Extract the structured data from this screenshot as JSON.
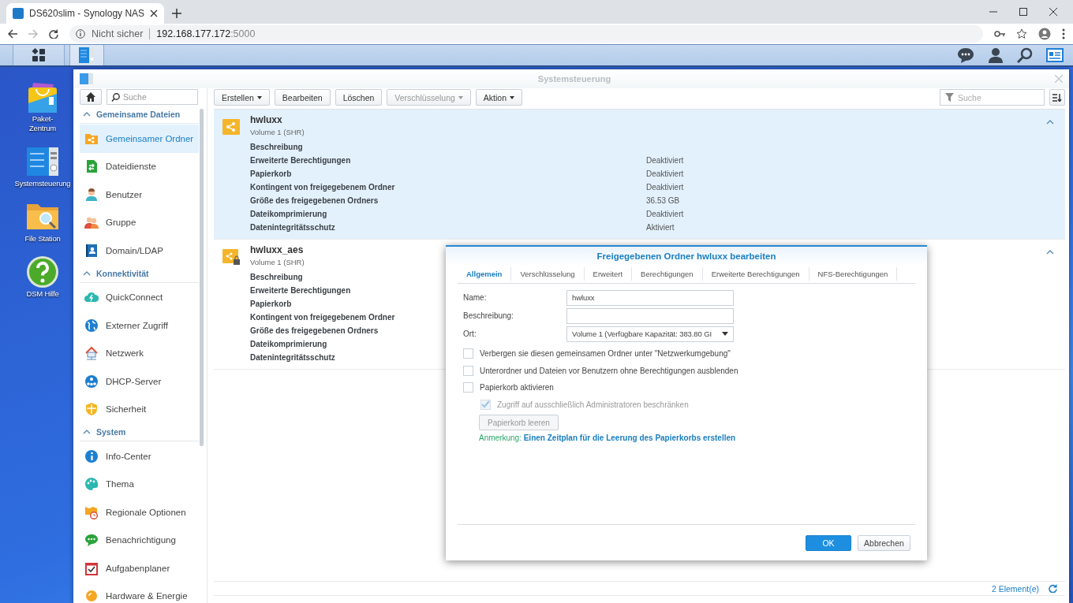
{
  "browser": {
    "tab_title": "DS620slim - Synology NAS",
    "security_label": "Nicht sicher",
    "url_host": "192.168.177.172",
    "url_port": ":5000"
  },
  "desktop_icons": [
    {
      "kind": "package",
      "label": "Paket-\nZentrum"
    },
    {
      "kind": "control-panel",
      "label": "Systemsteuerung"
    },
    {
      "kind": "file-station",
      "label": "File Station"
    },
    {
      "kind": "help",
      "label": "DSM Hilfe"
    }
  ],
  "window": {
    "title": "Systemsteuerung",
    "search": {
      "placeholder": "Suche"
    }
  },
  "sidebar": {
    "search": {
      "placeholder": "Suche"
    },
    "sections": [
      {
        "title": "Gemeinsame Dateien",
        "expanded": true,
        "items": [
          {
            "kind": "shared-folder",
            "label": "Gemeinsamer Ordner",
            "selected": true
          },
          {
            "kind": "file-services",
            "label": "Dateidienste",
            "selected": false
          },
          {
            "kind": "user",
            "label": "Benutzer",
            "selected": false
          },
          {
            "kind": "group",
            "label": "Gruppe",
            "selected": false
          },
          {
            "kind": "directory",
            "label": "Domain/LDAP",
            "selected": false
          }
        ]
      },
      {
        "title": "Konnektivität",
        "expanded": true,
        "items": [
          {
            "kind": "cloud",
            "label": "QuickConnect",
            "selected": false
          },
          {
            "kind": "globe",
            "label": "Externer Zugriff",
            "selected": false
          },
          {
            "kind": "house",
            "label": "Netzwerk",
            "selected": false
          },
          {
            "kind": "dhcp",
            "label": "DHCP-Server",
            "selected": false
          },
          {
            "kind": "shield",
            "label": "Sicherheit",
            "selected": false
          }
        ]
      },
      {
        "title": "System",
        "expanded": true,
        "items": [
          {
            "kind": "info",
            "label": "Info-Center",
            "selected": false
          },
          {
            "kind": "palette",
            "label": "Thema",
            "selected": false
          },
          {
            "kind": "regional",
            "label": "Regionale Optionen",
            "selected": false
          },
          {
            "kind": "chat",
            "label": "Benachrichtigung",
            "selected": false
          },
          {
            "kind": "calendar",
            "label": "Aufgabenplaner",
            "selected": false
          },
          {
            "kind": "bulb",
            "label": "Hardware & Energie",
            "selected": false
          }
        ]
      }
    ]
  },
  "toolbar": {
    "buttons": [
      {
        "label": "Erstellen",
        "dropdown": true,
        "disabled": false
      },
      {
        "label": "Bearbeiten",
        "dropdown": false,
        "disabled": false
      },
      {
        "label": "Löschen",
        "dropdown": false,
        "disabled": false
      },
      {
        "label": "Verschlüsselung",
        "dropdown": true,
        "disabled": true
      },
      {
        "label": "Aktion",
        "dropdown": true,
        "disabled": false
      }
    ]
  },
  "folders": [
    {
      "kind": "shared",
      "name": "hwluxx",
      "volume": "Volume 1 (SHR)",
      "selected": true,
      "expanded": true,
      "properties": [
        {
          "label": "Beschreibung"
        },
        {
          "label": "Erweiterte Berechtigungen",
          "value": "Deaktiviert"
        },
        {
          "label": "Papierkorb",
          "value": "Deaktiviert"
        },
        {
          "label": "Kontingent von freigegebenem Ordner",
          "value": "Deaktiviert"
        },
        {
          "label": "Größe des freigegebenen Ordners",
          "value": "36.53 GB"
        },
        {
          "label": "Dateikomprimierung",
          "value": "Deaktiviert"
        },
        {
          "label": "Datenintegritätsschutz",
          "value": "Aktiviert"
        }
      ]
    },
    {
      "kind": "encrypted",
      "name": "hwluxx_aes",
      "volume": "Volume 1 (SHR)",
      "selected": false,
      "expanded": true,
      "properties": [
        {
          "label": "Beschreibung"
        },
        {
          "label": "Erweiterte Berechtigungen"
        },
        {
          "label": "Papierkorb"
        },
        {
          "label": "Kontingent von freigegebenem Ordner"
        },
        {
          "label": "Größe des freigegebenen Ordners"
        },
        {
          "label": "Dateikomprimierung"
        },
        {
          "label": "Datenintegritätsschutz"
        }
      ]
    }
  ],
  "status_bar": {
    "count": "2 Element(e)"
  },
  "dialog": {
    "title": "Freigegebenen Ordner hwluxx bearbeiten",
    "tabs": [
      {
        "label": "Allgemein",
        "selected": true
      },
      {
        "label": "Verschlüsselung",
        "selected": false
      },
      {
        "label": "Erweitert",
        "selected": false
      },
      {
        "label": "Berechtigungen",
        "selected": false
      },
      {
        "label": "Erweiterte Berechtigungen",
        "selected": false
      },
      {
        "label": "NFS-Berechtigungen",
        "selected": false
      }
    ],
    "fields": [
      {
        "kind": "text",
        "label": "Name:",
        "value": "hwluxx"
      },
      {
        "kind": "text",
        "label": "Beschreibung:"
      },
      {
        "kind": "select",
        "label": "Ort:",
        "value": "Volume 1 (Verfügbare Kapazität: 383.80 GI"
      }
    ],
    "options": [
      {
        "label": "Verbergen sie diesen gemeinsamen Ordner unter \"Netzwerkumgebung\"",
        "checked": false,
        "disabled": false
      },
      {
        "label": "Unterordner und Dateien vor Benutzern ohne Berechtigungen ausblenden",
        "checked": false,
        "disabled": false
      },
      {
        "label": "Papierkorb aktivieren",
        "checked": false,
        "disabled": false,
        "children": [
          {
            "label": "Zugriff auf ausschließlich Administratoren beschränken",
            "checked": true,
            "disabled": true
          }
        ]
      }
    ],
    "empty_trash_button": {
      "label": "Papierkorb leeren",
      "disabled": true
    },
    "note": {
      "label": "Anmerkung:",
      "link": "Einen Zeitplan für die Leerung des Papierkorbs erstellen"
    },
    "buttons": [
      {
        "label": "OK",
        "kind": "primary"
      },
      {
        "label": "Abbrechen",
        "kind": "default"
      }
    ]
  }
}
